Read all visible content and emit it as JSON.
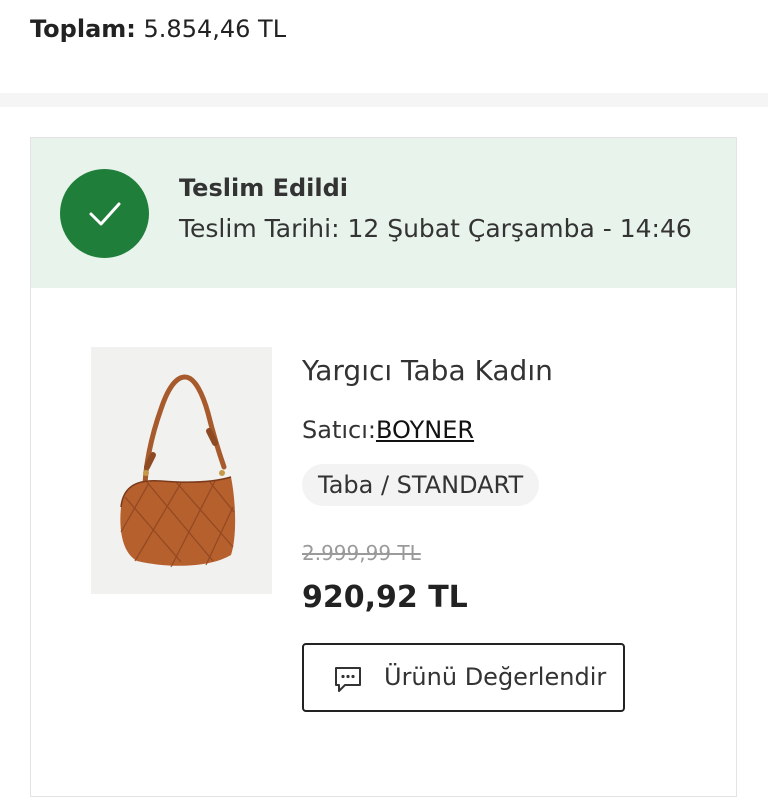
{
  "order": {
    "total_label": "Toplam:",
    "total_value": "5.854,46 TL"
  },
  "delivery": {
    "status": "Teslim Edildi",
    "date_text": "Teslim Tarihi: 12 Şubat Çarşamba - 14:46",
    "status_icon": "checkmark-icon",
    "status_color": "#1f7f3a",
    "banner_color": "#e8f3ec"
  },
  "product": {
    "name": "Yargıcı Taba Kadın",
    "seller_label": "Satıcı:",
    "seller_name": "BOYNER",
    "variant": "Taba / STANDART",
    "old_price": "2.999,99 TL",
    "price": "920,92 TL",
    "image": "quilted-shoulder-bag-tan"
  },
  "actions": {
    "review_label": "Ürünü Değerlendir",
    "review_icon": "comment-dots-icon"
  }
}
